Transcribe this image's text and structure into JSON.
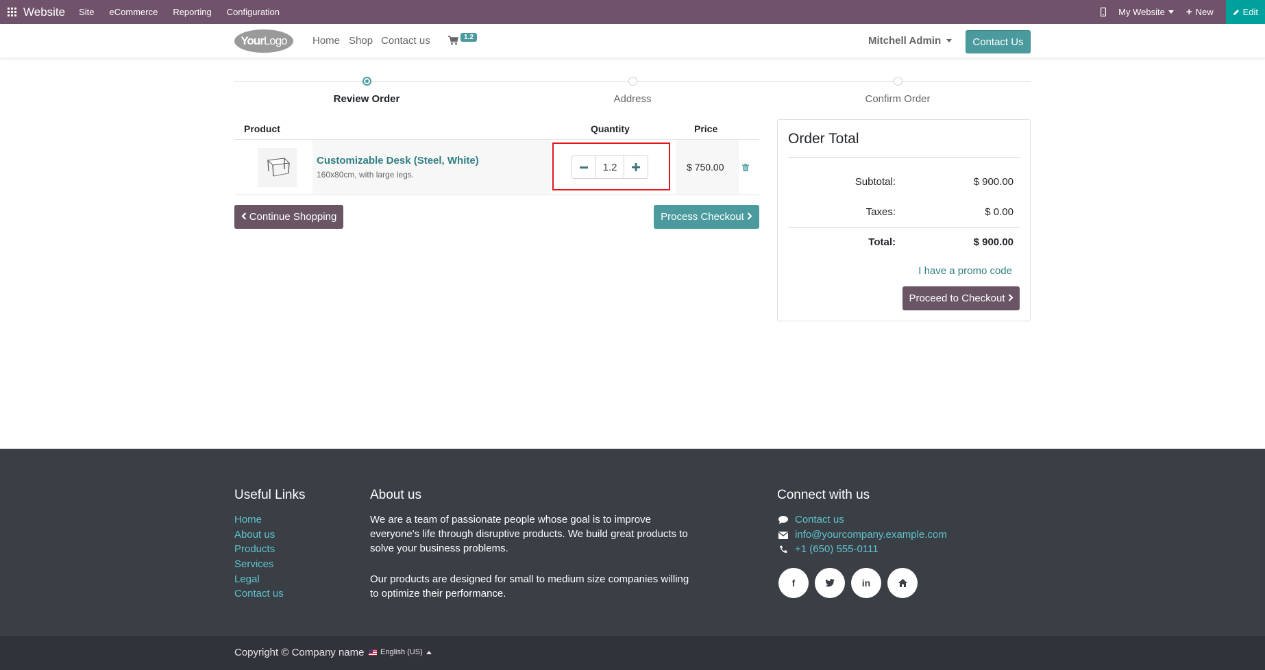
{
  "adminbar": {
    "app_name": "Website",
    "menus": [
      "Site",
      "eCommerce",
      "Reporting",
      "Configuration"
    ],
    "website_selector": "My Website",
    "new_label": "New",
    "edit_label": "Edit"
  },
  "header": {
    "logo_your": "Your",
    "logo_logo": "Logo",
    "nav": [
      "Home",
      "Shop",
      "Contact us"
    ],
    "cart_count": "1.2",
    "user_name": "Mitchell Admin",
    "contact_button": "Contact Us"
  },
  "wizard": {
    "steps": [
      {
        "label": "Review Order",
        "active": true
      },
      {
        "label": "Address",
        "active": false
      },
      {
        "label": "Confirm Order",
        "active": false
      }
    ]
  },
  "cart": {
    "headers": {
      "product": "Product",
      "quantity": "Quantity",
      "price": "Price"
    },
    "line": {
      "name": "Customizable Desk (Steel, White)",
      "description": "160x80cm, with large legs.",
      "quantity": "1.2",
      "price": "$ 750.00"
    },
    "continue_label": "Continue Shopping",
    "process_label": "Process Checkout"
  },
  "order_total": {
    "title": "Order Total",
    "subtotal_label": "Subtotal:",
    "subtotal_value": "$ 900.00",
    "taxes_label": "Taxes:",
    "taxes_value": "$ 0.00",
    "total_label": "Total:",
    "total_value": "$ 900.00",
    "promo_label": "I have a promo code",
    "proceed_label": "Proceed to Checkout"
  },
  "footer": {
    "useful_links_title": "Useful Links",
    "useful_links": [
      "Home",
      "About us",
      "Products",
      "Services",
      "Legal",
      "Contact us"
    ],
    "about_title": "About us",
    "about_p1": "We are a team of passionate people whose goal is to improve everyone's life through disruptive products. We build great products to solve your business problems.",
    "about_p2": "Our products are designed for small to medium size companies willing to optimize their performance.",
    "connect_title": "Connect with us",
    "contact_link": "Contact us",
    "email": "info@yourcompany.example.com",
    "phone": "+1 (650) 555-0111",
    "social": [
      "f",
      "in"
    ],
    "copyright": "Copyright © Company name",
    "language": "English (US)"
  },
  "colors": {
    "admin_bar": "#71526b",
    "primary": "#4b9b9e",
    "secondary": "#6a5565",
    "footer": "#3a3e45",
    "link_footer": "#5fc4cf",
    "highlight": "#e3141c"
  }
}
